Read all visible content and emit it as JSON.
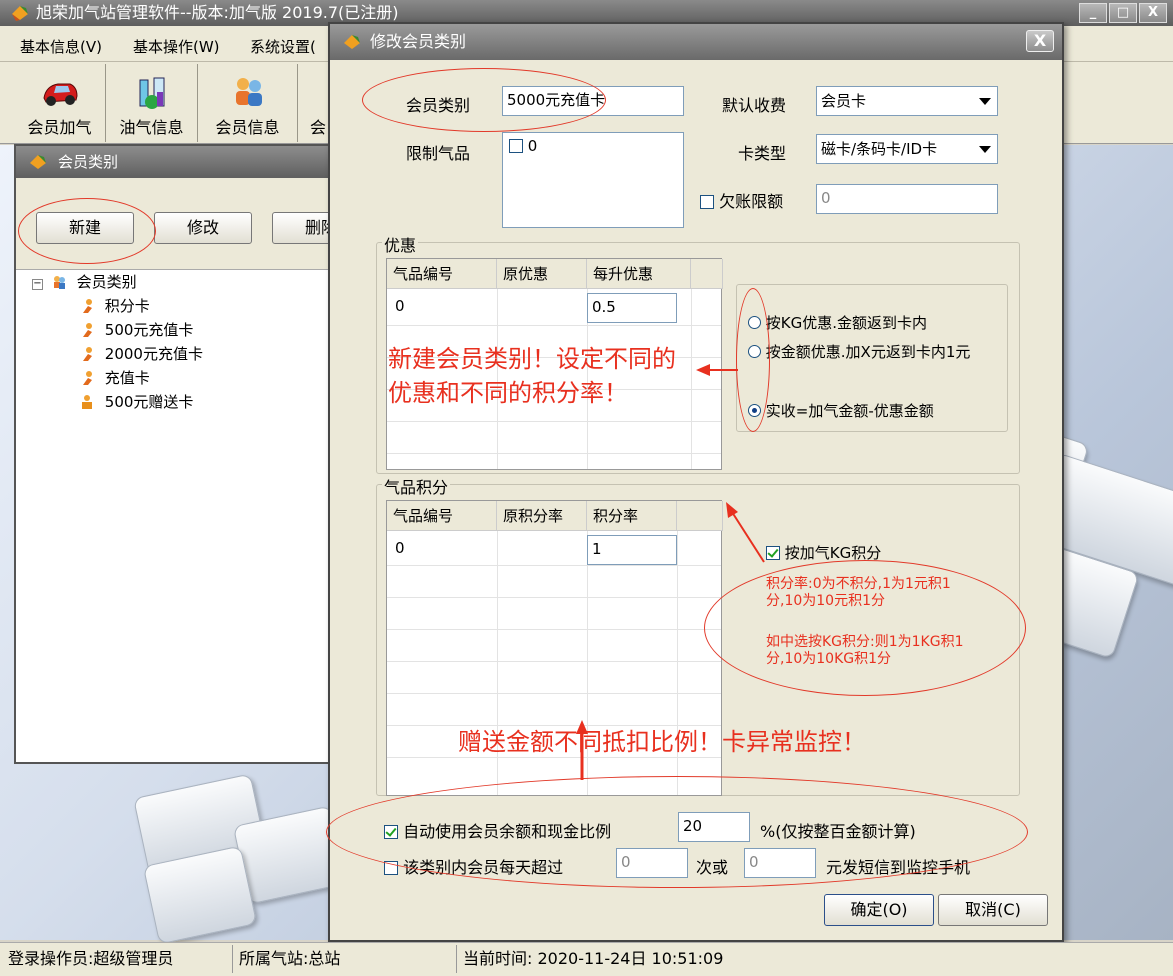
{
  "app": {
    "title": "旭荣加气站管理软件--版本:加气版 2019.7(已注册)",
    "window_buttons": [
      "_",
      "□",
      "X"
    ]
  },
  "menu": [
    "基本信息(V)",
    "基本操作(W)",
    "系统设置("
  ],
  "toolbar": [
    {
      "label": "会员加气",
      "icon": "car-icon"
    },
    {
      "label": "油气信息",
      "icon": "fuel-lab-icon"
    },
    {
      "label": "会员信息",
      "icon": "members-icon"
    },
    {
      "label": "会",
      "icon": "partial-icon"
    }
  ],
  "category_window": {
    "title": "会员类别",
    "buttons": {
      "new": "新建",
      "edit": "修改",
      "delete": "删除"
    },
    "tree_root": "会员类别",
    "tree_items": [
      "积分卡",
      "500元充值卡",
      "2000元充值卡",
      "充值卡",
      "500元赠送卡"
    ]
  },
  "dialog": {
    "title": "修改会员类别",
    "close": "X",
    "member_type_label": "会员类别",
    "member_type_value": "5000元充值卡",
    "default_charge_label": "默认收费",
    "default_charge_value": "会员卡",
    "limit_gas_label": "限制气品",
    "limit_gas_item": "0",
    "card_type_label": "卡类型",
    "card_type_value": "磁卡/条码卡/ID卡",
    "credit_limit_label": "欠账限额",
    "credit_limit_value": "0",
    "discount_group": "优惠",
    "discount_headers": [
      "气品编号",
      "原优惠",
      "每升优惠"
    ],
    "discount_row": {
      "code": "0",
      "orig": "",
      "per_liter": "0.5"
    },
    "discount_options": [
      "按KG优惠.金额返到卡内",
      "按金额优惠.加X元返到卡内1元",
      "实收=加气金额-优惠金额"
    ],
    "discount_selected": 2,
    "points_group": "气品积分",
    "points_headers": [
      "气品编号",
      "原积分率",
      "积分率"
    ],
    "points_row": {
      "code": "0",
      "orig": "",
      "rate": "1"
    },
    "points_by_kg_label": "按加气KG积分",
    "points_note_1": "积分率:0为不积分,1为1元积1分,10为10元积1分",
    "points_note_2": "如中选按KG积分:则1为1KG积1分,10为10KG积1分",
    "auto_balance_label": "自动使用会员余额和现金比例",
    "auto_balance_value": "20",
    "auto_balance_suffix": "%(仅按整百金额计算)",
    "daily_limit_label": "该类别内会员每天超过",
    "daily_limit_times": "0",
    "daily_or": "次或",
    "daily_amount": "0",
    "daily_suffix": "元发短信到监控手机",
    "ok": "确定(O)",
    "cancel": "取消(C)"
  },
  "annotations": {
    "note_1": "新建会员类别！设定不同的优惠和不同的积分率！",
    "note_2": "赠送金额不同抵扣比例！卡异常监控！"
  },
  "status": {
    "operator": "登录操作员:超级管理员",
    "station": "所属气站:总站",
    "time": "当前时间:  2020-11-24日 10:51:09"
  },
  "colors": {
    "annotation": "#e8301f",
    "window_bg": "#ece9d8"
  }
}
